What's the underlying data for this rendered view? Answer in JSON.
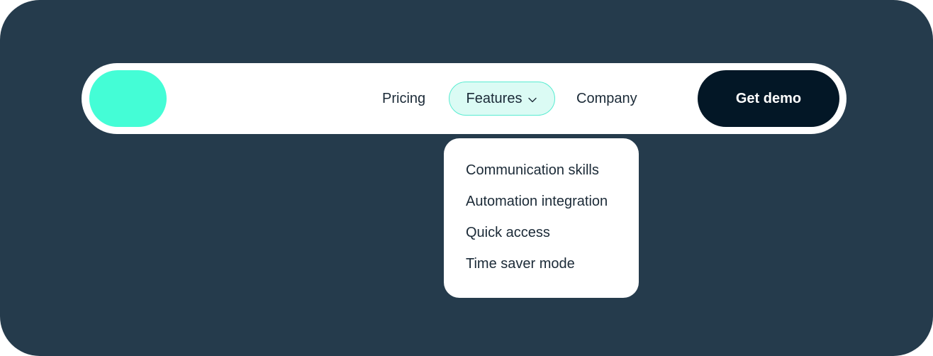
{
  "nav": {
    "pricing": "Pricing",
    "features": "Features",
    "company": "Company",
    "cta": "Get demo"
  },
  "dropdown": {
    "items": [
      "Communication skills",
      "Automation integration",
      "Quick access",
      "Time saver mode"
    ]
  },
  "icons": {
    "features_toggle": "chevron-down-icon"
  },
  "colors": {
    "background": "#253b4c",
    "logo": "#44fdd6",
    "features_highlight": "#dbfbf4",
    "features_border": "#58ecd1",
    "cta_background": "#031726",
    "text": "#1b2a37"
  }
}
